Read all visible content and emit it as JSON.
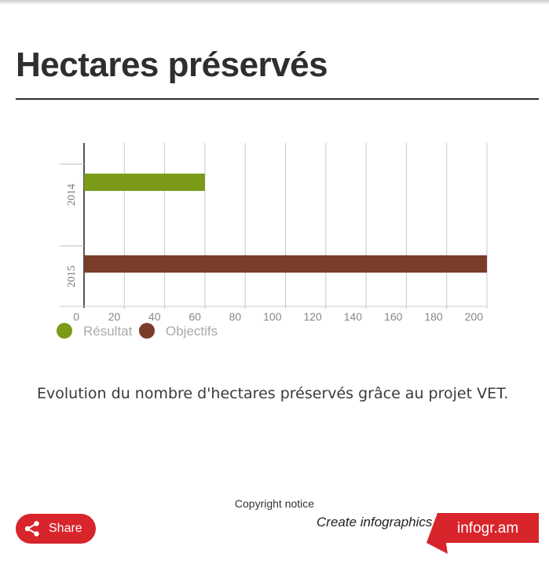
{
  "title": "Hectares préservés",
  "description": "Evolution du nombre d'hectares préservés grâce au projet VET.",
  "footer": {
    "copyright": "Copyright notice",
    "share_label": "Share",
    "create_text": "Create infographics",
    "brand": "infogr.am"
  },
  "colors": {
    "accent_red": "#d8242b",
    "resultat": "#7a9a18",
    "objectifs": "#7a3d2a"
  },
  "chart_data": {
    "type": "bar",
    "orientation": "horizontal",
    "categories": [
      "2014",
      "2015"
    ],
    "series": [
      {
        "name": "Résultat",
        "color": "#7a9a18",
        "values": [
          60,
          null
        ]
      },
      {
        "name": "Objectifs",
        "color": "#7a3d2a",
        "values": [
          null,
          200
        ]
      }
    ],
    "xlim": [
      0,
      200
    ],
    "xticks": [
      0,
      20,
      40,
      60,
      80,
      100,
      120,
      140,
      160,
      180,
      200
    ],
    "grid": true,
    "legend": "bottom-left"
  }
}
